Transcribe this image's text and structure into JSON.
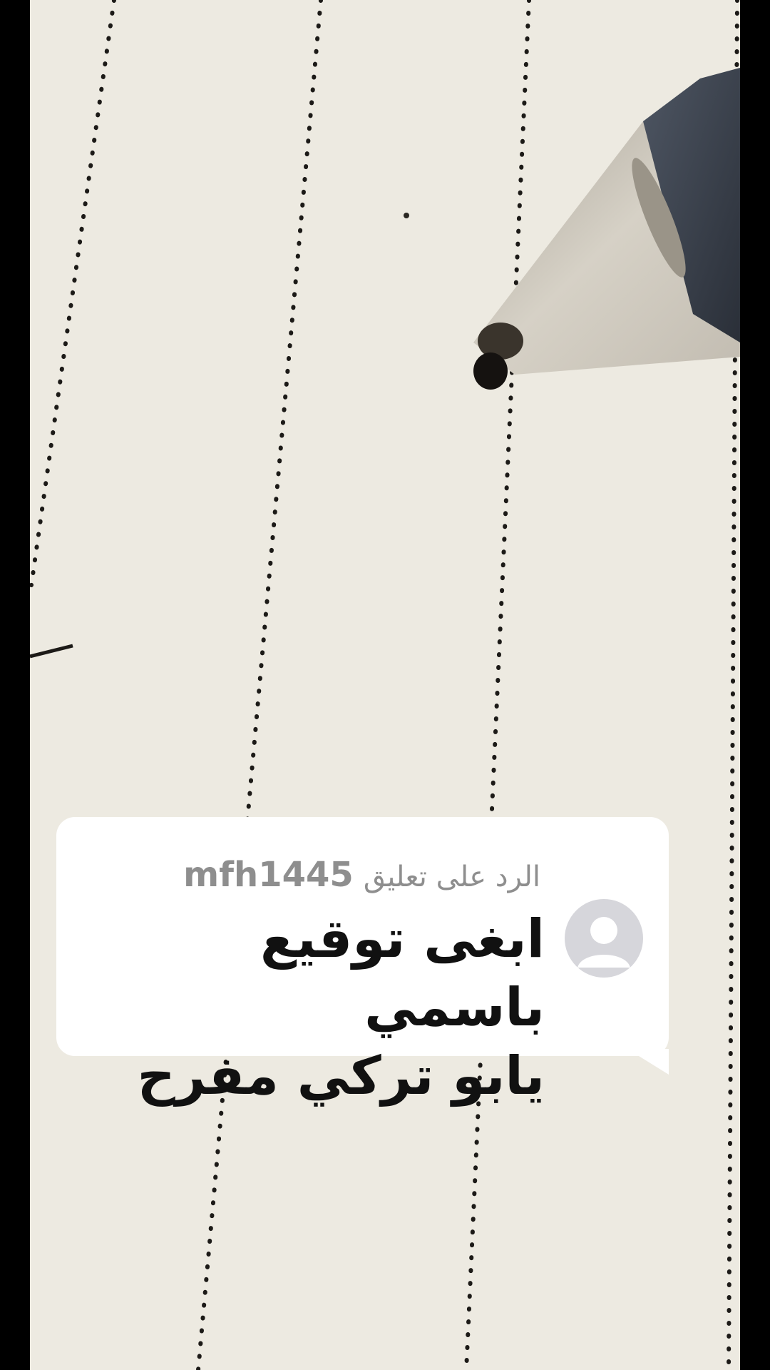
{
  "reply": {
    "prefix": "الرد على تعليق",
    "username": "mfh1445",
    "comment_line1": "ابغى توقيع باسمي",
    "comment_line2": "يابو تركي مفرح"
  },
  "icons": {
    "avatar": "default-user-avatar-icon"
  },
  "colors": {
    "paper": "#edeae1",
    "card": "#ffffff",
    "comment_text": "#111111",
    "muted_text": "#8e8e8e",
    "avatar_bg": "#d6d6db",
    "letterbox": "#000000"
  }
}
